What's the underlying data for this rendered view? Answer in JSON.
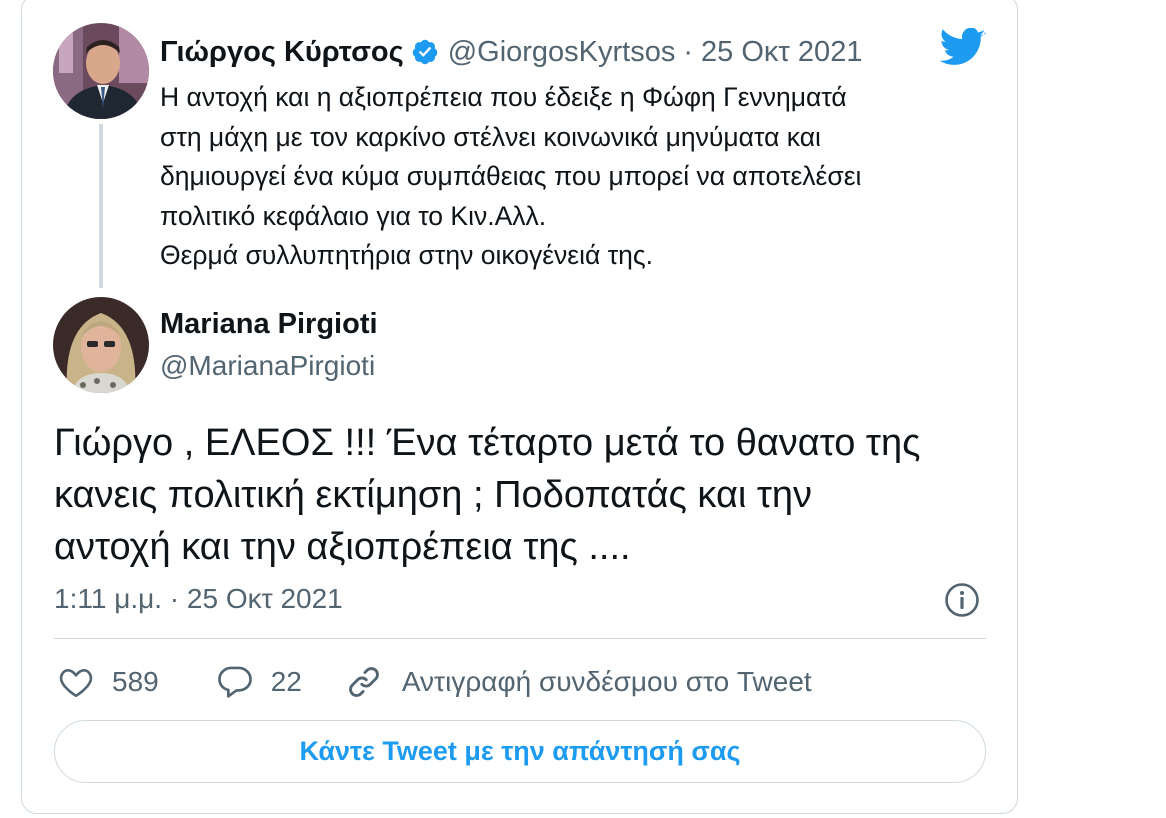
{
  "quoted_tweet": {
    "author_name": "Γιώργος Κύρτσος",
    "handle": "@GiorgosKyrtsos",
    "separator": "·",
    "date": "25 Οκτ 2021",
    "verified": true,
    "text_lines": [
      "Η αντοχή και η αξιοπρέπεια που έδειξε η Φώφη Γεννηματά",
      "στη μάχη με τον καρκίνο στέλνει κοινωνικά μηνύματα και",
      "δημιουργεί ένα κύμα συμπάθειας που μπορεί να αποτελέσει",
      "πολιτικό κεφάλαιο για το Κιν.Αλλ.",
      "Θερμά συλλυπητήρια στην οικογένειά της."
    ]
  },
  "reply_tweet": {
    "author_name": "Mariana Pirgioti",
    "handle": "@MarianaPirgioti",
    "text_lines": [
      "Γιώργο , ΕΛΕΟΣ !!! Ένα τέταρτο μετά το θανατο της",
      "κανεις πολιτική εκτίμηση ; Ποδοπατάς και την",
      "αντοχή και την αξιοπρέπεια της ...."
    ],
    "timestamp": "1:11 μ.μ. · 25 Οκτ 2021"
  },
  "actions": {
    "likes": "589",
    "replies": "22",
    "copy_link_label": "Αντιγραφή συνδέσμου στο Tweet"
  },
  "reply_button_label": "Κάντε Tweet με την απάντησή σας",
  "icons": {
    "brand": "twitter-bird-icon",
    "verified": "verified-badge-icon",
    "info": "info-icon",
    "like": "heart-icon",
    "reply": "reply-bubble-icon",
    "copy_link": "link-icon"
  },
  "colors": {
    "accent": "#1d9bf0",
    "text": "#0f1419",
    "secondary_text": "#536471",
    "border": "#cfd9de"
  }
}
